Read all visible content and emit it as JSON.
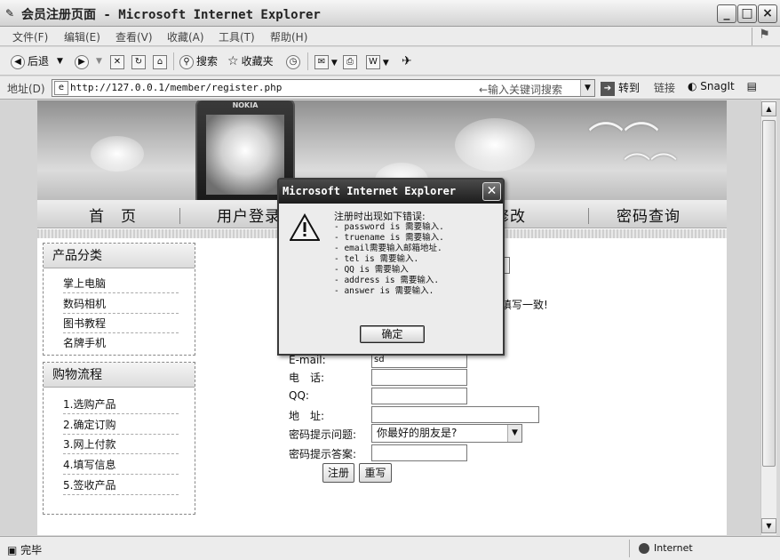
{
  "window": {
    "title": "会员注册页面 - Microsoft Internet Explorer",
    "controls": [
      "_",
      "□",
      "×"
    ]
  },
  "menubar": {
    "items": [
      "文件(F)",
      "编辑(E)",
      "查看(V)",
      "收藏(A)",
      "工具(T)",
      "帮助(H)"
    ]
  },
  "toolbar": {
    "back": "后退",
    "search": "搜索",
    "favorites": "收藏夹"
  },
  "address": {
    "label": "地址(D)",
    "url": "http://127.0.0.1/member/register.php",
    "search_hint": "←输入关键词搜索",
    "go": "转到",
    "links": "链接",
    "snagit": "SnagIt"
  },
  "page": {
    "banner_brand": "NOKIA",
    "nav": [
      "首　页",
      "用户登录",
      "资料修改",
      "密码查询"
    ],
    "categories": {
      "title": "产品分类",
      "items": [
        "掌上电脑",
        "数码相机",
        "图书教程",
        "名牌手机"
      ]
    },
    "process": {
      "title": "购物流程",
      "items": [
        "1.选购产品",
        "2.确定订购",
        "3.网上付款",
        "4.填写信息",
        "5.签收产品"
      ]
    },
    "form": {
      "note": "填写一致!",
      "email_label": "E-mail:",
      "email_value": "sd",
      "tel_label": "电　话:",
      "qq_label": "QQ:",
      "address_label": "地　址:",
      "question_label": "密码提示问题:",
      "question_value": "你最好的朋友是?",
      "answer_label": "密码提示答案:",
      "submit": "注册",
      "reset": "重写"
    }
  },
  "dialog": {
    "title": "Microsoft Internet Explorer",
    "heading": "注册时出现如下错误:",
    "errors": [
      "- password is 需要输入.",
      "- truename is 需要输入.",
      "- email需要输入邮箱地址.",
      "- tel is 需要输入.",
      "- QQ is 需要输入",
      "- address is 需要输入.",
      "- answer is 需要输入."
    ],
    "ok": "确定"
  },
  "statusbar": {
    "text": "完毕",
    "zone": "Internet"
  }
}
